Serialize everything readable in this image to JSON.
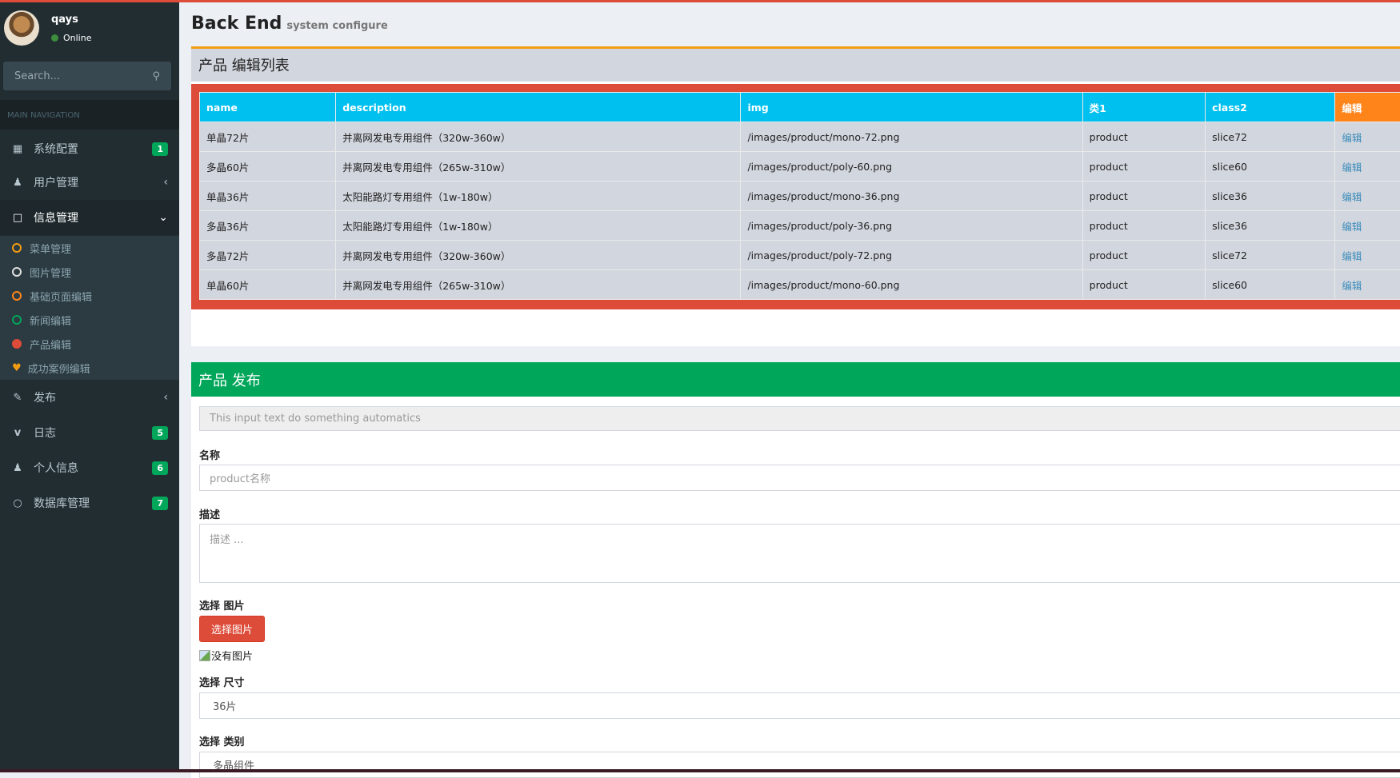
{
  "user": {
    "name": "qays",
    "status": "Online"
  },
  "search": {
    "placeholder": "Search..."
  },
  "nav": {
    "header": "MAIN NAVIGATION",
    "items": [
      {
        "label": "系统配置",
        "icon": "th-icon",
        "badge": "1"
      },
      {
        "label": "用户管理",
        "icon": "user-icon"
      },
      {
        "label": "信息管理",
        "icon": "laptop-icon"
      },
      {
        "label": "发布",
        "icon": "edit-icon"
      },
      {
        "label": "日志",
        "icon": "vimeo-icon",
        "badge": "5"
      },
      {
        "label": "个人信息",
        "icon": "user-icon",
        "badge": "6"
      },
      {
        "label": "数据库管理",
        "icon": "circle-icon",
        "badge": "7"
      }
    ],
    "subitems": [
      {
        "label": "菜单管理",
        "color": "#f39c12"
      },
      {
        "label": "图片管理",
        "color": "#e0e0e0"
      },
      {
        "label": "基础页面编辑",
        "color": "#ff851b"
      },
      {
        "label": "新闻编辑",
        "color": "#00a65a"
      },
      {
        "label": "产品编辑",
        "color": "#dd4b39"
      },
      {
        "label": "成功案例编辑",
        "color": "#f39c12"
      }
    ]
  },
  "page": {
    "title": "Back End",
    "subtitle": "system configure"
  },
  "list": {
    "title": "产品 编辑列表",
    "columns": [
      "name",
      "description",
      "img",
      "类1",
      "class2",
      "编辑"
    ],
    "rows": [
      [
        "单晶72片",
        "并离网发电专用组件（320w-360w）",
        "/images/product/mono-72.png",
        "product",
        "slice72",
        "编辑"
      ],
      [
        "多晶60片",
        "并离网发电专用组件（265w-310w）",
        "/images/product/poly-60.png",
        "product",
        "slice60",
        "编辑"
      ],
      [
        "单晶36片",
        "太阳能路灯专用组件（1w-180w）",
        "/images/product/mono-36.png",
        "product",
        "slice36",
        "编辑"
      ],
      [
        "多晶36片",
        "太阳能路灯专用组件（1w-180w）",
        "/images/product/poly-36.png",
        "product",
        "slice36",
        "编辑"
      ],
      [
        "多晶72片",
        "并离网发电专用组件（320w-360w）",
        "/images/product/poly-72.png",
        "product",
        "slice72",
        "编辑"
      ],
      [
        "单晶60片",
        "并离网发电专用组件（265w-310w）",
        "/images/product/mono-60.png",
        "product",
        "slice60",
        "编辑"
      ]
    ]
  },
  "form": {
    "title": "产品 发布",
    "auto_placeholder": "This input text do something automatics",
    "name_label": "名称",
    "name_placeholder": "product名称",
    "desc_label": "描述",
    "desc_placeholder": "描述 ...",
    "img_label": "选择 图片",
    "img_button": "选择图片",
    "img_alt": "没有图片",
    "size_label": "选择 尺寸",
    "size_value": "36片",
    "class_label": "选择 类别",
    "class_value": "多晶组件"
  },
  "colors": {
    "accent": "#dd4b39",
    "header": "#00c0ef",
    "success": "#00a65a",
    "warning": "#f39c12"
  }
}
